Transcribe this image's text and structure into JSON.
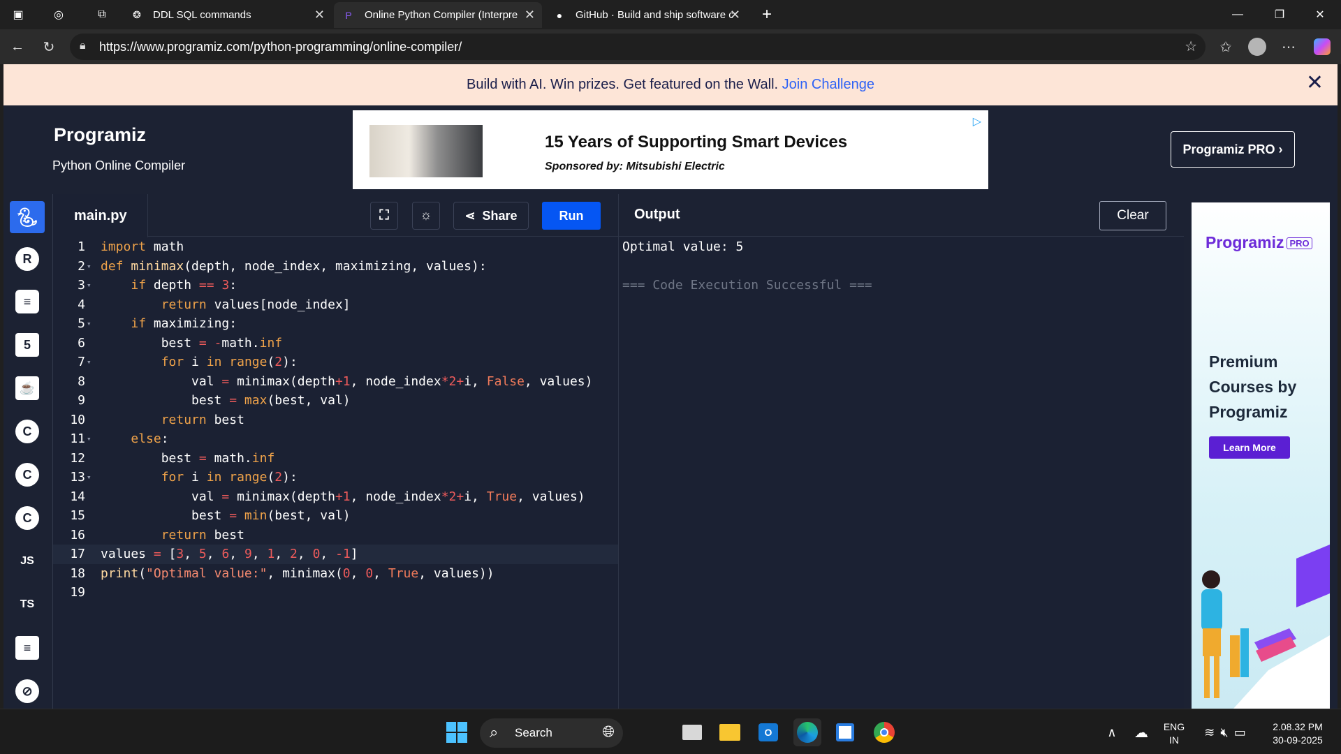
{
  "browser": {
    "tabs": [
      {
        "title": "DDL SQL commands",
        "active": false
      },
      {
        "title": "Online Python Compiler (Interpre",
        "active": true
      },
      {
        "title": "GitHub · Build and ship software c",
        "active": false
      }
    ],
    "url": "https://www.programiz.com/python-programming/online-compiler/"
  },
  "banner": {
    "text": "Build with AI. Win prizes. Get featured on the Wall.",
    "link": "Join Challenge"
  },
  "header": {
    "logo": "Programiz",
    "subtitle": "Python Online Compiler",
    "ad_title": "15 Years of Supporting Smart Devices",
    "ad_sponsor": "Sponsored by: Mitsubishi Electric",
    "pro_button": "Programiz PRO ›"
  },
  "sidebar": {
    "languages": [
      {
        "name": "python",
        "label": "",
        "active": true
      },
      {
        "name": "r",
        "label": "R"
      },
      {
        "name": "sql",
        "label": "≡"
      },
      {
        "name": "html",
        "label": "5"
      },
      {
        "name": "java",
        "label": "☕"
      },
      {
        "name": "c",
        "label": "C"
      },
      {
        "name": "cpp",
        "label": "C"
      },
      {
        "name": "csharp",
        "label": "C"
      },
      {
        "name": "js",
        "label": "JS"
      },
      {
        "name": "ts",
        "label": "TS"
      },
      {
        "name": "go",
        "label": "≡"
      },
      {
        "name": "php",
        "label": "⊘"
      }
    ]
  },
  "editor": {
    "filename": "main.py",
    "share_label": "Share",
    "run_label": "Run"
  },
  "output": {
    "title": "Output",
    "clear_label": "Clear",
    "result": "Optimal value: 5",
    "status": "=== Code Execution Successful ==="
  },
  "right_ad": {
    "logo": "Programiz",
    "badge": "PRO",
    "title": "Premium Courses by Programiz",
    "button": "Learn More"
  },
  "taskbar": {
    "search_placeholder": "Search",
    "lang_top": "ENG",
    "lang_bottom": "IN",
    "time": "2.08.32 PM",
    "date": "30-09-2025"
  },
  "colors": {
    "accent": "#0556f3",
    "banner_bg": "#fde5d7",
    "editor_bg": "#1b2133",
    "promo_purple": "#5b1fd3"
  }
}
